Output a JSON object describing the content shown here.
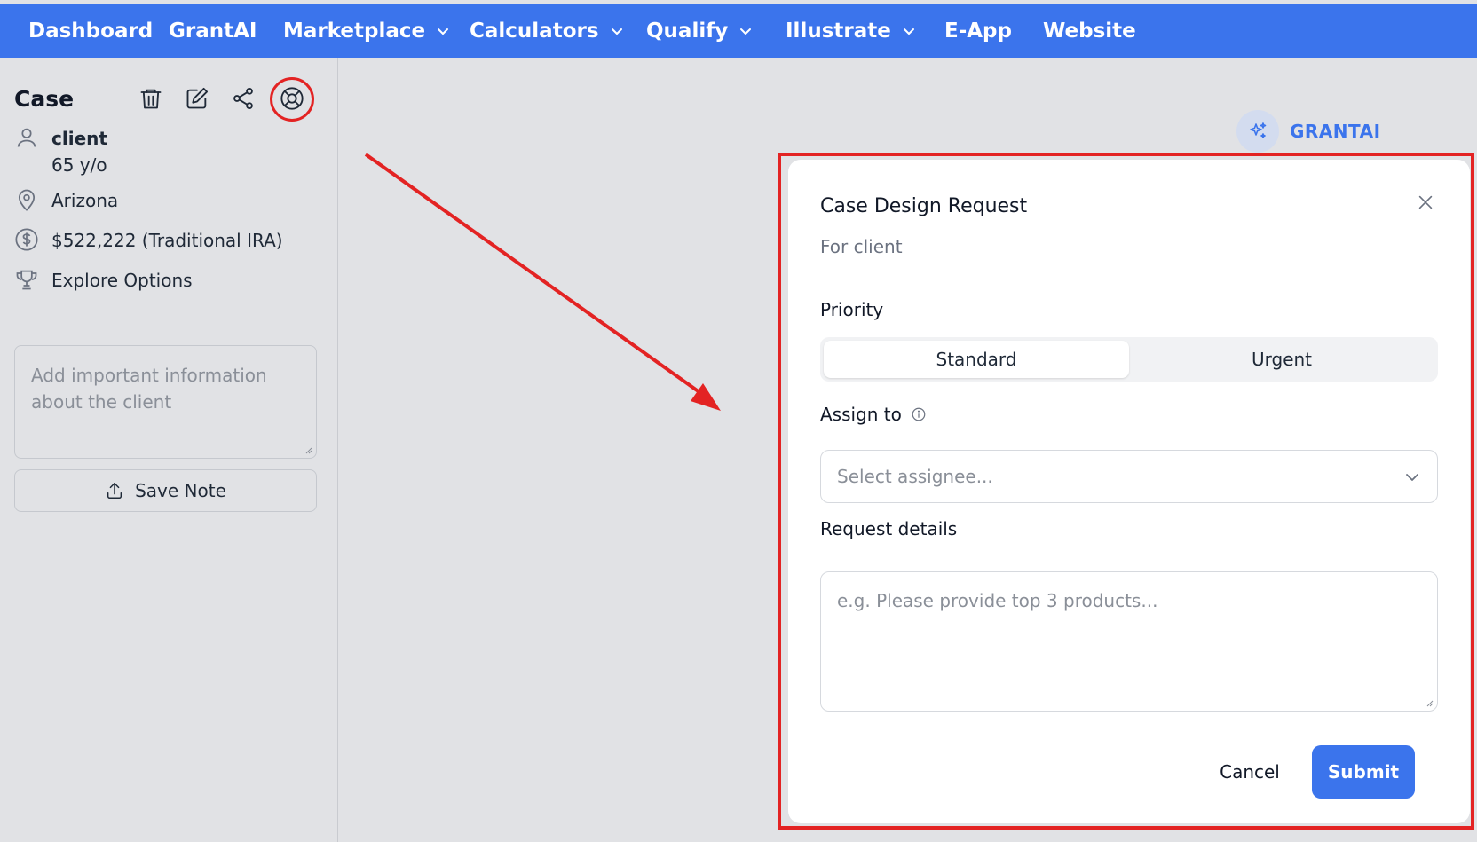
{
  "nav": {
    "items": [
      {
        "label": "Dashboard",
        "dropdown": false
      },
      {
        "label": "GrantAI",
        "dropdown": false
      },
      {
        "label": "Marketplace",
        "dropdown": true
      },
      {
        "label": "Calculators",
        "dropdown": true
      },
      {
        "label": "Qualify",
        "dropdown": true
      },
      {
        "label": "Illustrate",
        "dropdown": true
      },
      {
        "label": "E-App",
        "dropdown": false
      },
      {
        "label": "Website",
        "dropdown": false
      }
    ]
  },
  "sidebar": {
    "title": "Case",
    "client_name": "client",
    "client_age": "65 y/o",
    "state": "Arizona",
    "account": "$522,222 (Traditional IRA)",
    "goal": "Explore Options",
    "note_placeholder": "Add important information about the client",
    "save_note_label": "Save Note"
  },
  "grantai": {
    "label": "GRANTAI"
  },
  "modal": {
    "title": "Case Design Request",
    "subtitle": "For client",
    "priority_label": "Priority",
    "priority_options": [
      "Standard",
      "Urgent"
    ],
    "priority_selected": "Standard",
    "assign_label": "Assign to",
    "assign_placeholder": "Select assignee...",
    "details_label": "Request details",
    "details_placeholder": "e.g. Please provide top 3 products...",
    "cancel_label": "Cancel",
    "submit_label": "Submit"
  },
  "colors": {
    "nav_bg": "#3b74ec",
    "accent": "#3b74ec",
    "annotation_red": "#e32323",
    "page_bg": "#e1e2e5"
  }
}
